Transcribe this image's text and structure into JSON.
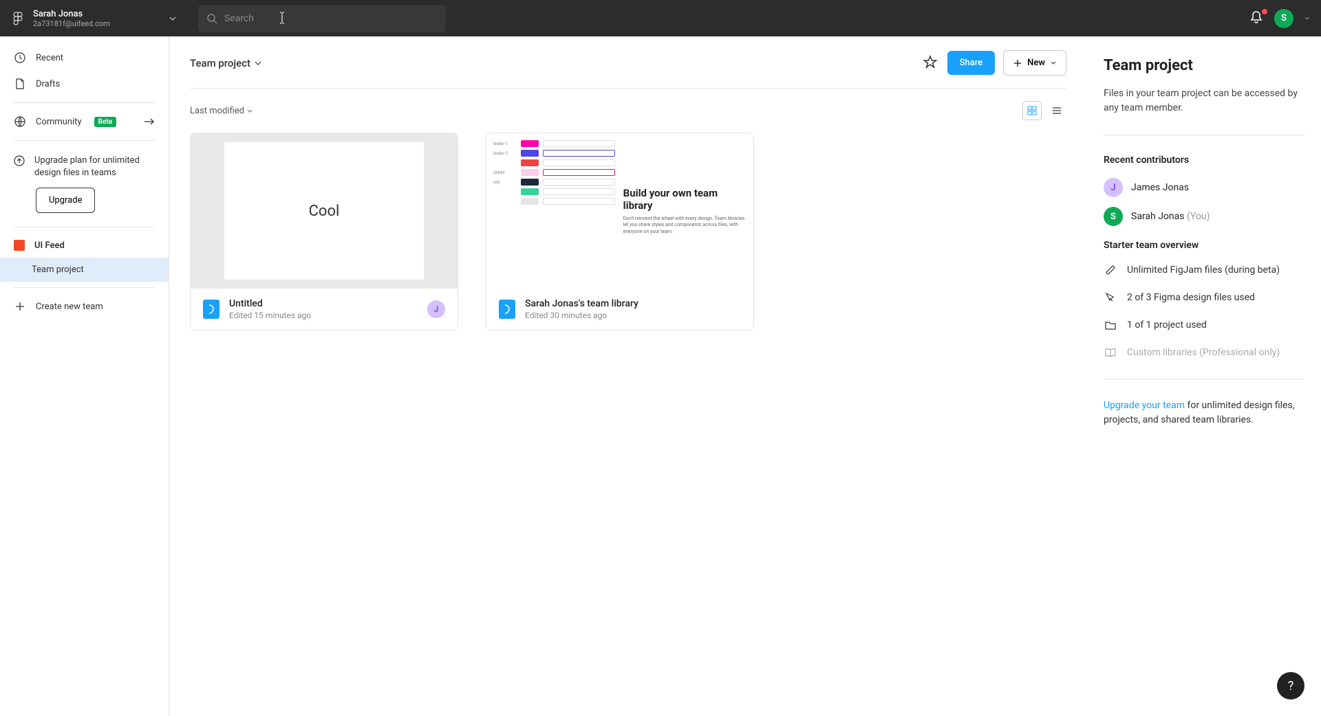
{
  "topbar": {
    "user_name": "Sarah Jonas",
    "user_email": "2a73181f@uifeed.com",
    "search_placeholder": "Search",
    "avatar_initial": "S"
  },
  "sidebar": {
    "recent": "Recent",
    "drafts": "Drafts",
    "community": "Community",
    "beta": "Beta",
    "upgrade_text": "Upgrade plan for unlimited design files in teams",
    "upgrade_btn": "Upgrade",
    "team_name": "UI Feed",
    "project_name": "Team project",
    "create_team": "Create new team"
  },
  "header": {
    "breadcrumb": "Team project",
    "share": "Share",
    "new": "New"
  },
  "filters": {
    "sort": "Last modified"
  },
  "files": [
    {
      "thumb_text": "Cool",
      "name": "Untitled",
      "edited": "Edited 15 minutes ago",
      "avatar_initial": "J"
    },
    {
      "name": "Sarah Jonas's team library",
      "edited": "Edited 30 minutes ago",
      "lib_title": "Build your own team library",
      "lib_desc": "Don't reinvent the wheel with every design. Team libraries let you share styles and components across files, with everyone on your team."
    }
  ],
  "rightpanel": {
    "title": "Team project",
    "desc": "Files in your team project can be accessed by any team member.",
    "contributors_title": "Recent contributors",
    "contributors": [
      {
        "initial": "J",
        "name": "James Jonas",
        "color": "#d4bfff",
        "you": ""
      },
      {
        "initial": "S",
        "name": "Sarah Jonas",
        "color": "#0fa958",
        "you": "(You)"
      }
    ],
    "overview_title": "Starter team overview",
    "overview": [
      "Unlimited FigJam files (during beta)",
      "2 of 3 Figma design files used",
      "1 of 1 project used",
      "Custom libraries (Professional only)"
    ],
    "upgrade_link": "Upgrade your team",
    "upgrade_rest": " for unlimited design files, projects, and shared team libraries."
  },
  "help": "?"
}
